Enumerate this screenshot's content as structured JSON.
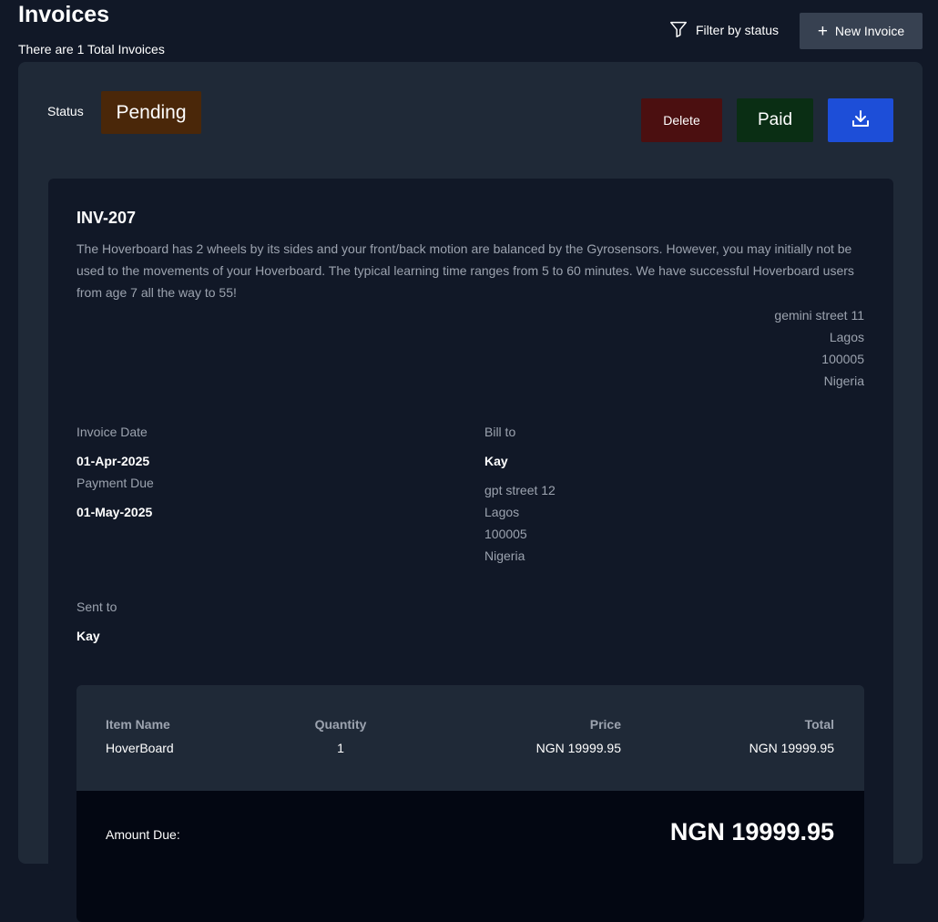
{
  "header": {
    "title": "Invoices",
    "subtitle": "There are 1 Total Invoices",
    "filter_label": "Filter by status",
    "new_invoice_label": "New Invoice"
  },
  "status": {
    "label": "Status",
    "value": "Pending",
    "color": "#4a2709"
  },
  "actions": {
    "delete_label": "Delete",
    "paid_label": "Paid"
  },
  "invoice": {
    "id": "INV-207",
    "description": "The Hoverboard has 2 wheels by its sides and your front/back motion are balanced by the Gyrosensors. However, you may initially not be used to the movements of your Hoverboard. The typical learning time ranges from 5 to 60 minutes. We have successful Hoverboard users from age 7 all the way to 55!",
    "sender_address": {
      "street": "gemini street 11",
      "city": "Lagos",
      "postcode": "100005",
      "country": "Nigeria"
    },
    "invoice_date_label": "Invoice Date",
    "invoice_date": "01-Apr-2025",
    "payment_due_label": "Payment Due",
    "payment_due": "01-May-2025",
    "bill_to_label": "Bill to",
    "bill_to_name": "Kay",
    "bill_to_address": {
      "street": "gpt street 12",
      "city": "Lagos",
      "postcode": "100005",
      "country": "Nigeria"
    },
    "sent_to_label": "Sent to",
    "sent_to": "Kay"
  },
  "items_table": {
    "headers": [
      "Item Name",
      "Quantity",
      "Price",
      "Total"
    ],
    "rows": [
      [
        "HoverBoard",
        "1",
        "NGN 19999.95",
        "NGN 19999.95"
      ]
    ],
    "amount_due_label": "Amount Due:",
    "amount_due": "NGN 19999.95"
  },
  "colors": {
    "page_bg": "#111827",
    "card_bg": "#1f2937",
    "accent_blue": "#1d4ed8",
    "delete_bg": "#4b0f10",
    "paid_bg": "#0a2e14"
  },
  "icons": {
    "filter": "filter-icon",
    "plus": "plus-icon",
    "download": "download-icon"
  }
}
